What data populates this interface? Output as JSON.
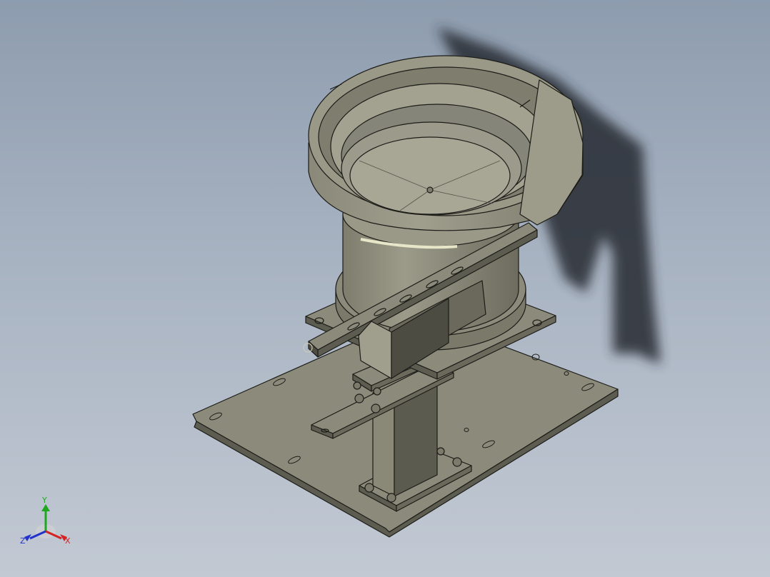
{
  "viewport": {
    "background_top": "#8d9cae",
    "background_bottom": "#c2c9d3",
    "part_color": "#8c8b7b",
    "edge_color": "#1c1c18",
    "shadow_color": "#262a30"
  },
  "triad": {
    "x_label": "X",
    "y_label": "Y",
    "z_label": "Z",
    "x_color": "#d52222",
    "y_color": "#1fa81f",
    "z_color": "#2233cc"
  }
}
